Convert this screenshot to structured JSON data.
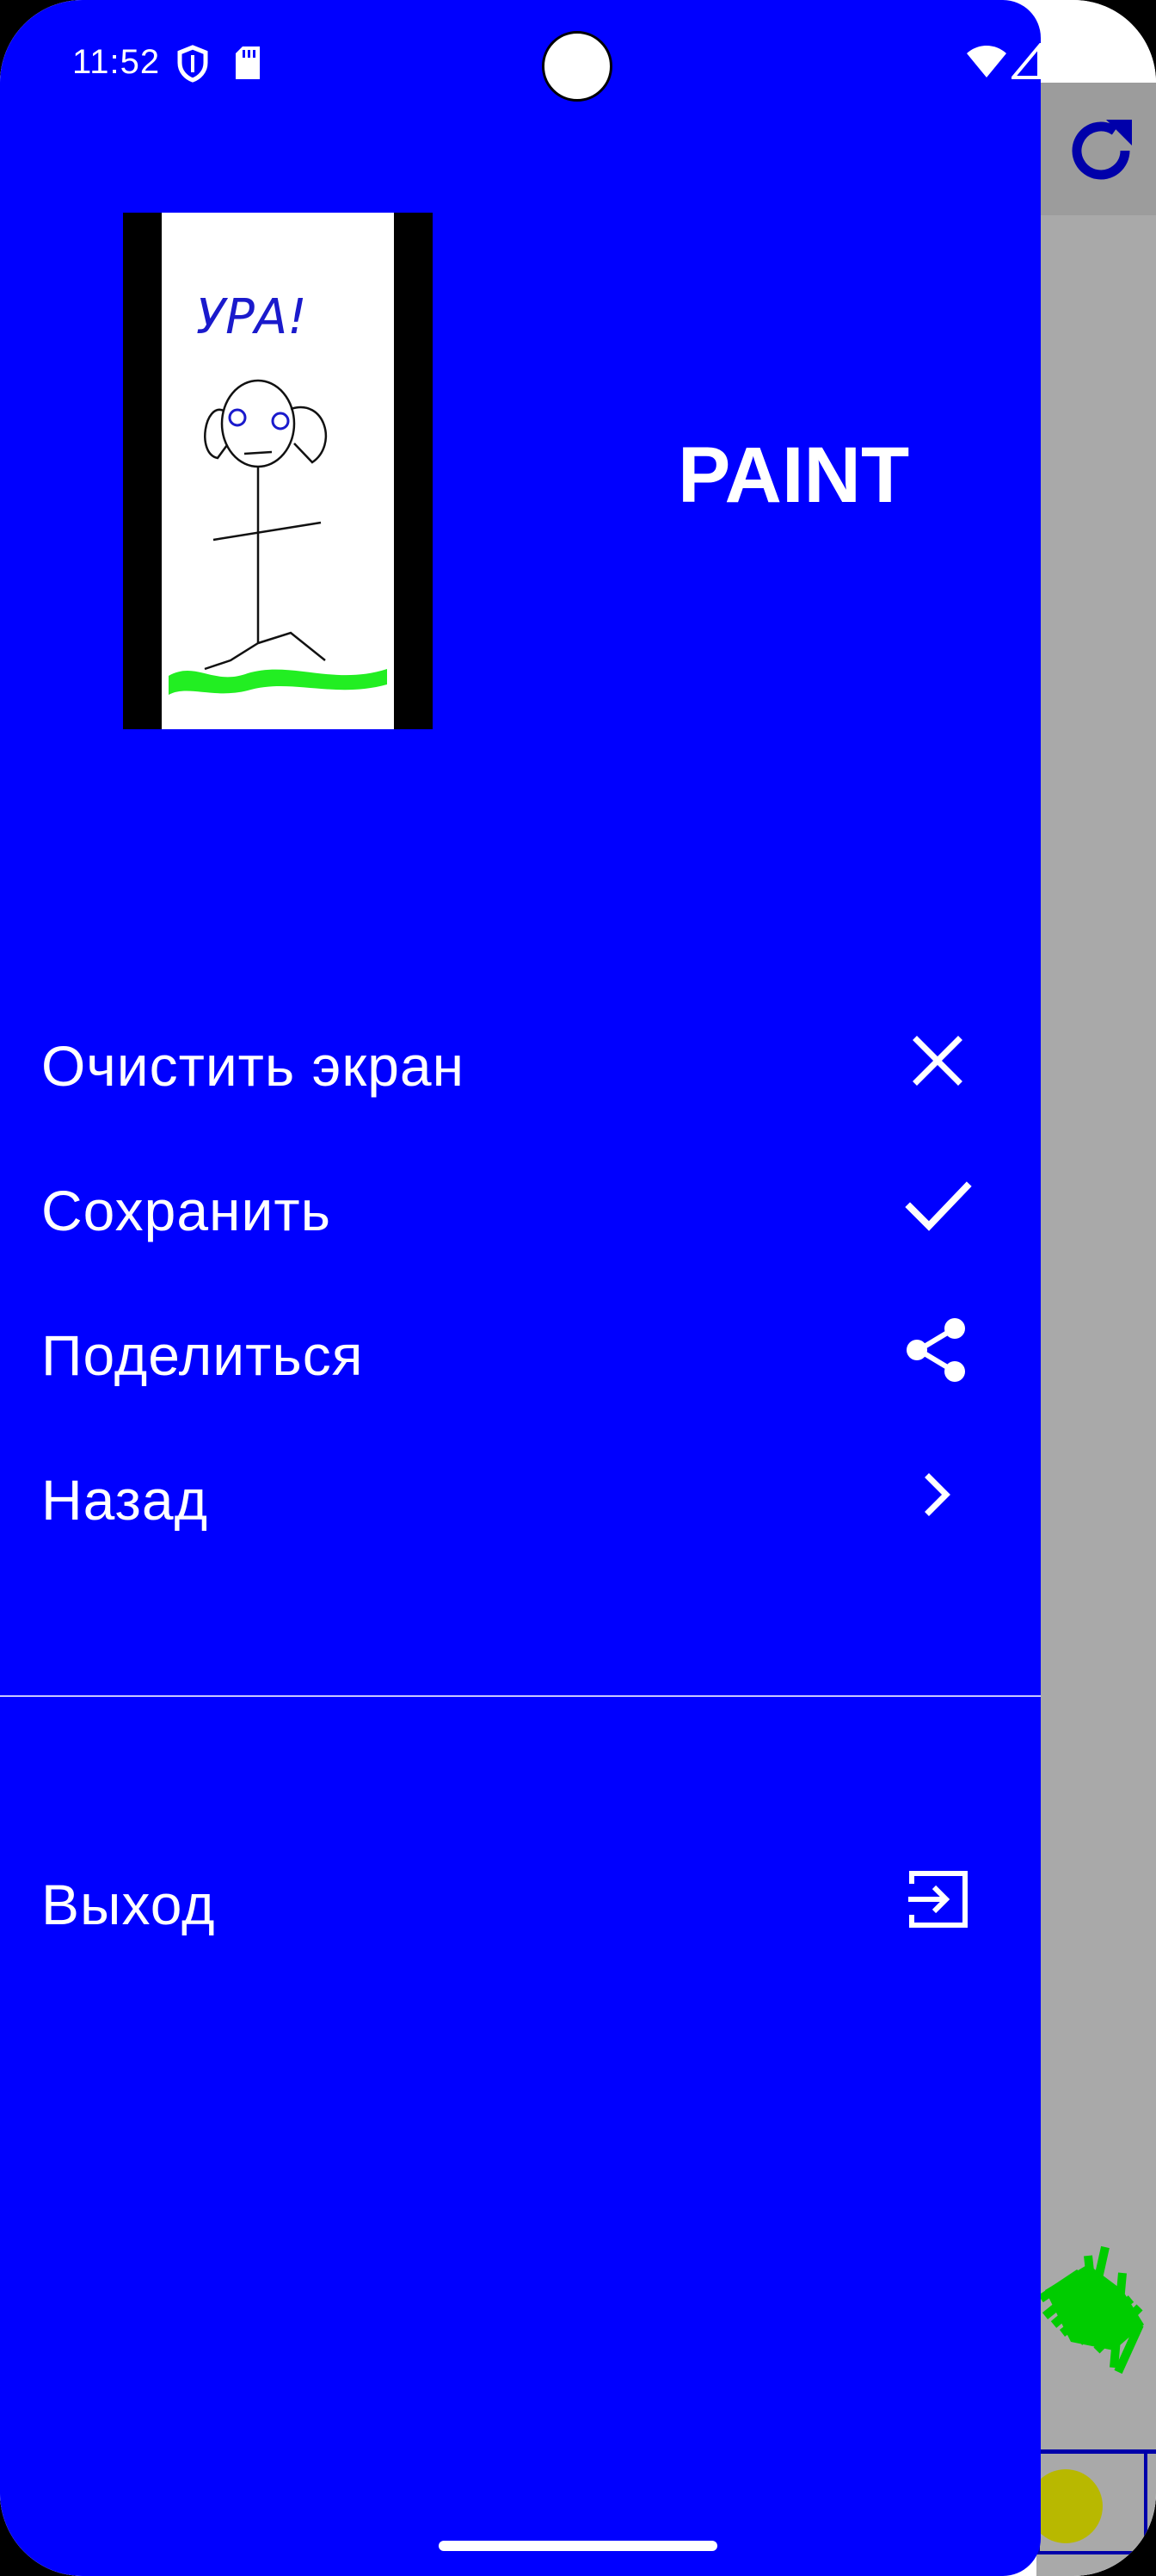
{
  "status_bar": {
    "time": "11:52"
  },
  "drawer": {
    "app_title": "PAINT",
    "thumbnail_text": "УРА!",
    "menu": [
      {
        "label": "Очистить экран",
        "icon": "close-icon"
      },
      {
        "label": "Сохранить",
        "icon": "check-icon"
      },
      {
        "label": "Поделиться",
        "icon": "share-icon"
      },
      {
        "label": "Назад",
        "icon": "chevron-right-icon"
      }
    ],
    "exit": {
      "label": "Выход",
      "icon": "exit-icon"
    }
  },
  "background_app": {
    "toolbar_icon": "refresh-icon"
  },
  "colors": {
    "drawer_bg": "#0000ff",
    "text": "#ffffff",
    "canvas_bg": "#a9a9a9",
    "toolbar_bg": "#9c9c9c",
    "refresh_icon": "#0000aa",
    "grass": "#00cc00",
    "selected_color": "#b8b800"
  }
}
